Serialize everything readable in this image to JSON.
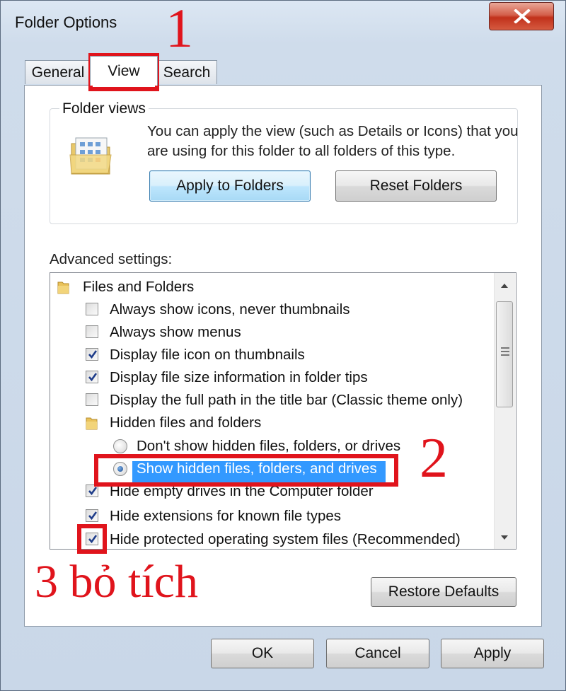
{
  "window": {
    "title": "Folder Options",
    "close_icon": "close-icon"
  },
  "tabs": [
    {
      "label": "General",
      "active": false
    },
    {
      "label": "View",
      "active": true
    },
    {
      "label": "Search",
      "active": false
    }
  ],
  "folder_views": {
    "title": "Folder views",
    "description": "You can apply the view (such as Details or Icons) that you are using for this folder to all folders of this type.",
    "apply_button": "Apply to Folders",
    "reset_button": "Reset Folders"
  },
  "advanced": {
    "label": "Advanced settings:",
    "items": [
      {
        "type": "folder",
        "label": "Files and Folders"
      },
      {
        "type": "checkbox",
        "label": "Always show icons, never thumbnails",
        "checked": false
      },
      {
        "type": "checkbox",
        "label": "Always show menus",
        "checked": false
      },
      {
        "type": "checkbox",
        "label": "Display file icon on thumbnails",
        "checked": true
      },
      {
        "type": "checkbox",
        "label": "Display file size information in folder tips",
        "checked": true
      },
      {
        "type": "checkbox",
        "label": "Display the full path in the title bar (Classic theme only)",
        "checked": false
      },
      {
        "type": "folder",
        "label": "Hidden files and folders"
      },
      {
        "type": "radio",
        "label": "Don't show hidden files, folders, or drives",
        "checked": false
      },
      {
        "type": "radio",
        "label": "Show hidden files, folders, and drives",
        "checked": true,
        "selected": true
      },
      {
        "type": "checkbox",
        "label": "Hide empty drives in the Computer folder",
        "checked": true
      },
      {
        "type": "checkbox",
        "label": "Hide extensions for known file types",
        "checked": true
      },
      {
        "type": "checkbox",
        "label": "Hide protected operating system files (Recommended)",
        "checked": true
      }
    ]
  },
  "restore_button": "Restore Defaults",
  "footer": {
    "ok": "OK",
    "cancel": "Cancel",
    "apply": "Apply"
  },
  "annotations": {
    "step1": "1",
    "step2": "2",
    "step3": "3 bỏ tích"
  },
  "colors": {
    "annotation": "#e0141c",
    "selection": "#3399ff"
  }
}
